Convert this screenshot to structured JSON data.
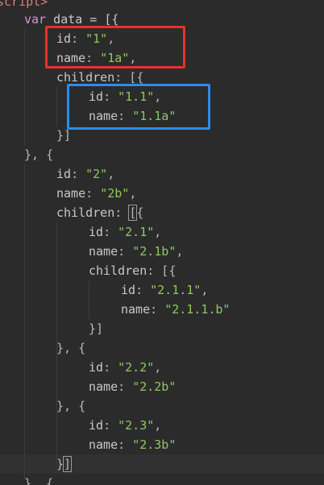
{
  "colors": {
    "background": "#2b2b2b",
    "keyword": "#cc99cd",
    "string": "#8fc860",
    "plain": "#c8c8c8",
    "tag": "#e07a7a",
    "red_box": "#e8322b",
    "blue_box": "#2a8ee8"
  },
  "editor": {
    "lines": [
      {
        "tokens": [
          {
            "t": "script>",
            "c": "tag"
          }
        ]
      },
      {
        "tokens": [
          {
            "t": "var",
            "c": "kw"
          },
          {
            "t": " data = [{",
            "c": "var"
          }
        ]
      },
      {
        "tokens": [
          {
            "t": "id",
            "c": "key"
          },
          {
            "t": ": ",
            "c": "punct"
          },
          {
            "t": "\"1\"",
            "c": "str"
          },
          {
            "t": ",",
            "c": "punct"
          }
        ]
      },
      {
        "tokens": [
          {
            "t": "name",
            "c": "key"
          },
          {
            "t": ": ",
            "c": "punct"
          },
          {
            "t": "\"1a\"",
            "c": "str"
          },
          {
            "t": ",",
            "c": "punct"
          }
        ]
      },
      {
        "tokens": [
          {
            "t": "children",
            "c": "key"
          },
          {
            "t": ": [{",
            "c": "punct"
          }
        ]
      },
      {
        "tokens": [
          {
            "t": "id",
            "c": "key"
          },
          {
            "t": ": ",
            "c": "punct"
          },
          {
            "t": "\"1.1\"",
            "c": "str"
          },
          {
            "t": ",",
            "c": "punct"
          }
        ]
      },
      {
        "tokens": [
          {
            "t": "name",
            "c": "key"
          },
          {
            "t": ": ",
            "c": "punct"
          },
          {
            "t": "\"1.1a\"",
            "c": "str"
          }
        ]
      },
      {
        "tokens": [
          {
            "t": "}]",
            "c": "punct"
          }
        ]
      },
      {
        "tokens": [
          {
            "t": "}, {",
            "c": "punct"
          }
        ]
      },
      {
        "tokens": [
          {
            "t": "id",
            "c": "key"
          },
          {
            "t": ": ",
            "c": "punct"
          },
          {
            "t": "\"2\"",
            "c": "str"
          },
          {
            "t": ",",
            "c": "punct"
          }
        ]
      },
      {
        "tokens": [
          {
            "t": "name",
            "c": "key"
          },
          {
            "t": ": ",
            "c": "punct"
          },
          {
            "t": "\"2b\"",
            "c": "str"
          },
          {
            "t": ",",
            "c": "punct"
          }
        ]
      },
      {
        "tokens": [
          {
            "t": "children",
            "c": "key"
          },
          {
            "t": ": ",
            "c": "punct"
          },
          {
            "t": "[",
            "c": "punct",
            "match": true
          },
          {
            "t": "{",
            "c": "punct"
          }
        ]
      },
      {
        "tokens": [
          {
            "t": "id",
            "c": "key"
          },
          {
            "t": ": ",
            "c": "punct"
          },
          {
            "t": "\"2.1\"",
            "c": "str"
          },
          {
            "t": ",",
            "c": "punct"
          }
        ]
      },
      {
        "tokens": [
          {
            "t": "name",
            "c": "key"
          },
          {
            "t": ": ",
            "c": "punct"
          },
          {
            "t": "\"2.1b\"",
            "c": "str"
          },
          {
            "t": ",",
            "c": "punct"
          }
        ]
      },
      {
        "tokens": [
          {
            "t": "children",
            "c": "key"
          },
          {
            "t": ": [{",
            "c": "punct"
          }
        ]
      },
      {
        "tokens": [
          {
            "t": "id",
            "c": "key"
          },
          {
            "t": ": ",
            "c": "punct"
          },
          {
            "t": "\"2.1.1\"",
            "c": "str"
          },
          {
            "t": ",",
            "c": "punct"
          }
        ]
      },
      {
        "tokens": [
          {
            "t": "name",
            "c": "key"
          },
          {
            "t": ": ",
            "c": "punct"
          },
          {
            "t": "\"2.1.1.b\"",
            "c": "str"
          }
        ]
      },
      {
        "tokens": [
          {
            "t": "}]",
            "c": "punct"
          }
        ]
      },
      {
        "tokens": [
          {
            "t": "}, {",
            "c": "punct"
          }
        ]
      },
      {
        "tokens": [
          {
            "t": "id",
            "c": "key"
          },
          {
            "t": ": ",
            "c": "punct"
          },
          {
            "t": "\"2.2\"",
            "c": "str"
          },
          {
            "t": ",",
            "c": "punct"
          }
        ]
      },
      {
        "tokens": [
          {
            "t": "name",
            "c": "key"
          },
          {
            "t": ": ",
            "c": "punct"
          },
          {
            "t": "\"2.2b\"",
            "c": "str"
          }
        ]
      },
      {
        "tokens": [
          {
            "t": "}, {",
            "c": "punct"
          }
        ]
      },
      {
        "tokens": [
          {
            "t": "id",
            "c": "key"
          },
          {
            "t": ": ",
            "c": "punct"
          },
          {
            "t": "\"2.3\"",
            "c": "str"
          },
          {
            "t": ",",
            "c": "punct"
          }
        ]
      },
      {
        "tokens": [
          {
            "t": "name",
            "c": "key"
          },
          {
            "t": ": ",
            "c": "punct"
          },
          {
            "t": "\"2.3b\"",
            "c": "str"
          }
        ]
      },
      {
        "tokens": [
          {
            "t": "}",
            "c": "punct"
          },
          {
            "t": "]",
            "c": "punct",
            "match": true
          }
        ]
      },
      {
        "tokens": [
          {
            "t": "}, {",
            "c": "punct"
          }
        ]
      }
    ]
  }
}
